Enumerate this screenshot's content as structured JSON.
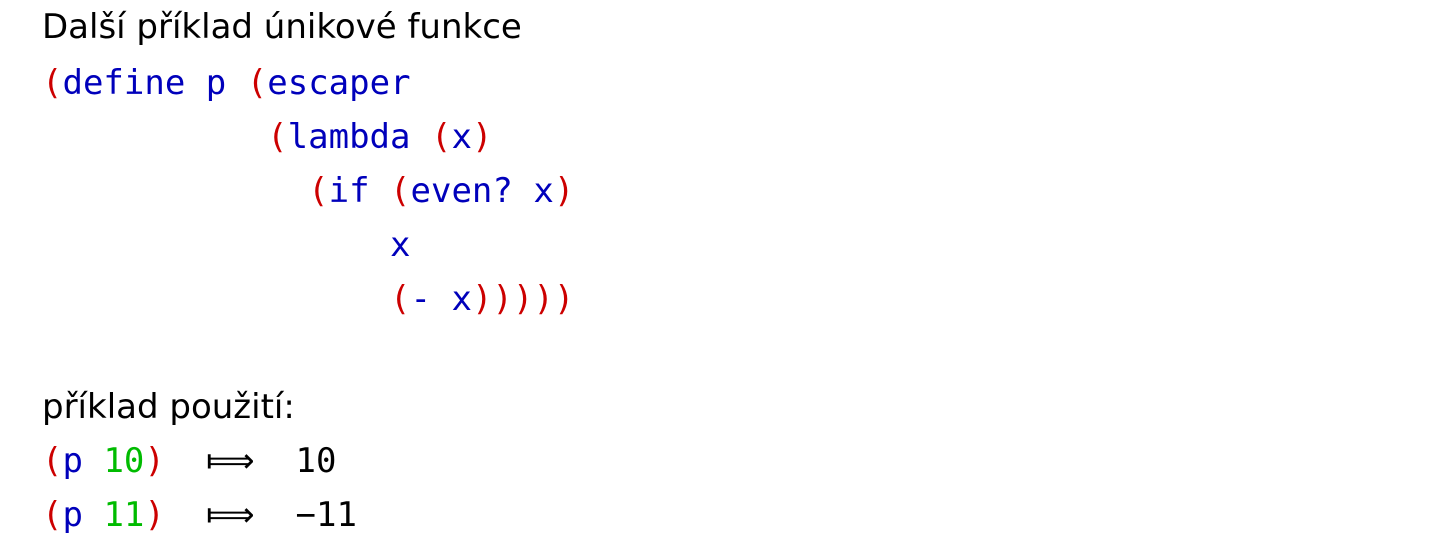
{
  "title": "Další příklad únikové funkce",
  "code": {
    "line1": {
      "open1": "(",
      "kw_define": "define",
      "name": "p",
      "open2": "(",
      "kw_escaper": "escaper"
    },
    "line2": {
      "indent": "           ",
      "open1": "(",
      "kw_lambda": "lambda",
      "open2": "(",
      "param": "x",
      "close": ")"
    },
    "line3": {
      "indent": "             ",
      "open1": "(",
      "kw_if": "if",
      "open2": "(",
      "pred": "even?",
      "arg": "x",
      "close": ")"
    },
    "line4": {
      "indent": "                 ",
      "value": "x"
    },
    "line5": {
      "indent": "                 ",
      "open": "(",
      "op": "-",
      "arg": "x",
      "close": ")))))"
    }
  },
  "usage_heading": "příklad použití:",
  "examples": [
    {
      "open": "(",
      "fn": "p",
      "arg": "10",
      "close": ")",
      "arrow": "⟾",
      "result": "10"
    },
    {
      "open": "(",
      "fn": "p",
      "arg": "11",
      "close": ")",
      "arrow": "⟾",
      "result": "−11"
    }
  ],
  "colors": {
    "paren": "#cc0000",
    "symbol": "#0000bb",
    "number": "#00bb00",
    "text": "#000000"
  }
}
